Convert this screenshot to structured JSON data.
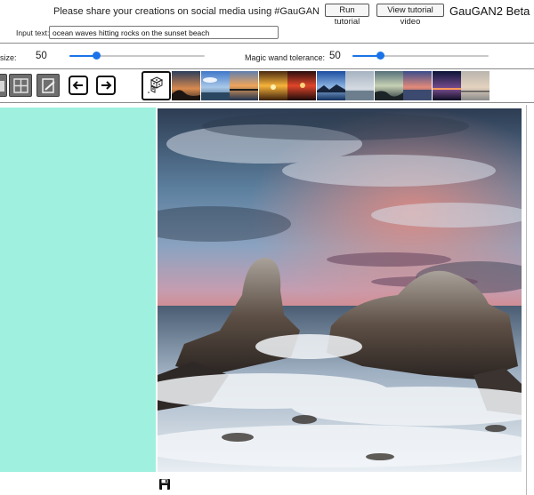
{
  "header": {
    "share_text": "Please share your creations on social media using #GauGAN",
    "run_tutorial_label": "Run tutorial",
    "view_tutorial_label": "View tutorial video",
    "brand": "GauGAN2 Beta",
    "input_label": "Input text:",
    "input_value": "ocean waves hitting rocks on the sunset beach"
  },
  "sliders": {
    "brush_size_label": "size:",
    "brush_size_value": "50",
    "brush_size_fraction": 0.2,
    "magic_wand_label": "Magic wand tolerance:",
    "magic_wand_value": "50",
    "magic_wand_fraction": 0.2
  },
  "toolbar": {
    "tools": [
      "fill-tool-icon",
      "grid-tool-icon",
      "edit-tool-icon",
      "arrow-left-icon",
      "arrow-right-icon",
      "dice-icon"
    ],
    "style_thumbnails": [
      "sunset-rocks-thumbnail",
      "blue-sky-thumbnail",
      "harbor-sunset-thumbnail",
      "orange-sunset-thumbnail",
      "red-sky-thumbnail",
      "blue-lake-thumbnail",
      "misty-coast-thumbnail",
      "lake-dusk-thumbnail",
      "purple-sunset-thumbnail",
      "night-horizon-thumbnail",
      "pale-beach-thumbnail"
    ]
  },
  "canvas": {
    "segmentation_color": "#9ff0de",
    "result_description_icon": "generated-image",
    "save_icon": "save-icon"
  },
  "colors": {
    "accent": "#1a73e8",
    "segmentation": "#9ff0de"
  }
}
